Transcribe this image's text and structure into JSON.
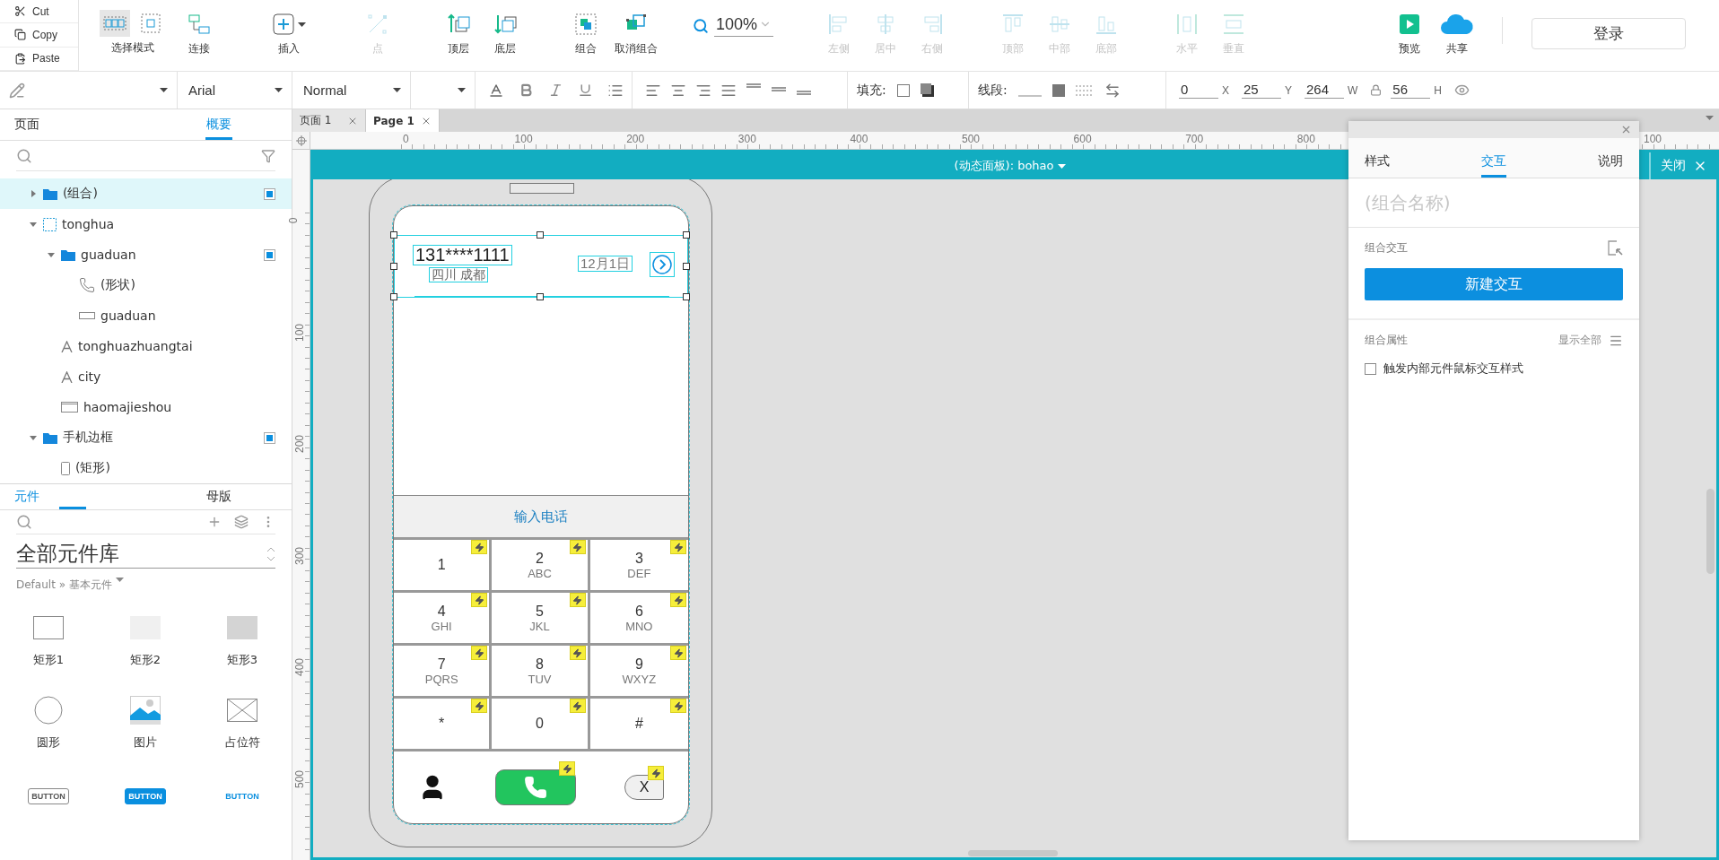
{
  "clipboard": [
    {
      "label": "Cut",
      "kind": "cut"
    },
    {
      "label": "Copy",
      "kind": "copy"
    },
    {
      "label": "Paste",
      "kind": "paste"
    }
  ],
  "select_mode": {
    "label": "选择模式",
    "modes": [
      {
        "kind": "intersect",
        "selected": true
      },
      {
        "kind": "contain",
        "selected": false
      }
    ]
  },
  "toolbar_left": [
    [
      {
        "label": "连接",
        "kind": "connect",
        "disabled": false
      }
    ],
    [
      {
        "label": "插入",
        "kind": "insert",
        "disabled": false
      }
    ],
    [
      {
        "label": "点",
        "kind": "point",
        "disabled": true
      }
    ],
    [
      {
        "label": "顶层",
        "kind": "front",
        "disabled": false
      },
      {
        "label": "底层",
        "kind": "back",
        "disabled": false
      }
    ],
    [
      {
        "label": "组合",
        "kind": "group",
        "disabled": false
      },
      {
        "label": "取消组合",
        "kind": "ungroup",
        "disabled": false
      }
    ]
  ],
  "zoom": "100%",
  "toolbar_align": [
    [
      {
        "label": "左侧",
        "kind": "align-left",
        "disabled": true
      },
      {
        "label": "居中",
        "kind": "align-center",
        "disabled": true
      },
      {
        "label": "右侧",
        "kind": "align-right",
        "disabled": true
      }
    ],
    [
      {
        "label": "顶部",
        "kind": "align-top",
        "disabled": true
      },
      {
        "label": "中部",
        "kind": "align-middle",
        "disabled": true
      },
      {
        "label": "底部",
        "kind": "align-bottom",
        "disabled": true
      }
    ],
    [
      {
        "label": "水平",
        "kind": "distribute-h",
        "disabled": true
      },
      {
        "label": "垂直",
        "kind": "distribute-v",
        "disabled": true
      }
    ]
  ],
  "toolbar_right": [
    {
      "label": "预览",
      "kind": "preview",
      "disabled": false
    },
    {
      "label": "共享",
      "kind": "share",
      "disabled": false
    }
  ],
  "login": "登录",
  "format_bar": {
    "font": "Arial",
    "style": "Normal",
    "fill_label": "填充:",
    "line_label": "线段:",
    "coords": [
      {
        "value": "0",
        "axis": "X"
      },
      {
        "value": "25",
        "axis": "Y"
      },
      {
        "value": "264",
        "axis": "W"
      },
      {
        "value": "56",
        "axis": "H"
      }
    ]
  },
  "outline": {
    "tabs": [
      {
        "label": "页面",
        "selected": false
      },
      {
        "label": "概要",
        "selected": true
      }
    ],
    "tree": [
      {
        "label": "(组合)",
        "kind": "folder",
        "expanded": false,
        "selected": true,
        "marker": true
      },
      {
        "label": "tonghua",
        "kind": "dynamic-panel",
        "expanded": true,
        "selected": false,
        "marker": false,
        "children": [
          {
            "label": "guaduan",
            "kind": "folder",
            "expanded": true,
            "selected": false,
            "marker": true,
            "children": [
              {
                "label": "(形状)",
                "kind": "phone",
                "selected": false,
                "marker": false
              },
              {
                "label": "guaduan",
                "kind": "rect",
                "selected": false,
                "marker": false
              }
            ]
          },
          {
            "label": "tonghuazhuangtai",
            "kind": "text",
            "selected": false,
            "marker": false
          },
          {
            "label": "city",
            "kind": "text",
            "selected": false,
            "marker": false
          },
          {
            "label": "haomajieshou",
            "kind": "field",
            "selected": false,
            "marker": false
          }
        ]
      },
      {
        "label": "手机边框",
        "kind": "folder",
        "expanded": true,
        "selected": false,
        "marker": true,
        "children": [
          {
            "label": "(矩形)",
            "kind": "mobile",
            "selected": false,
            "marker": false
          }
        ]
      }
    ]
  },
  "widgets": {
    "tabs": [
      {
        "label": "元件",
        "selected": true
      },
      {
        "label": "母版",
        "selected": false
      }
    ],
    "library": "全部元件库",
    "breadcrumb": "Default » 基本元件",
    "items": [
      {
        "kind": "rect1",
        "label": "矩形1"
      },
      {
        "kind": "rect2",
        "label": "矩形2"
      },
      {
        "kind": "rect3",
        "label": "矩形3"
      },
      {
        "kind": "circle",
        "label": "圆形"
      },
      {
        "kind": "image",
        "label": "图片"
      },
      {
        "kind": "placeholder",
        "label": "占位符"
      },
      {
        "kind": "button",
        "text": "BUTTON"
      },
      {
        "kind": "primary-button",
        "text": "BUTTON"
      },
      {
        "kind": "link-button",
        "text": "BUTTON"
      }
    ]
  },
  "doc_tabs": [
    {
      "label": "页面 1",
      "selected": false
    },
    {
      "label": "Page 1",
      "selected": true
    }
  ],
  "ruler": {
    "horizontal": [
      "0",
      "100",
      "200",
      "300",
      "400",
      "500",
      "600",
      "700",
      "800"
    ],
    "horizontal_tail": "100",
    "vertical": [
      "0",
      "100",
      "200",
      "300",
      "400",
      "500"
    ]
  },
  "stage": {
    "panel_name": "(动态面板): bohao",
    "close": "关闭"
  },
  "phone": {
    "number": "131****1111",
    "city": "四川 成都",
    "date": "12月1日",
    "input_label": "输入电话",
    "keys": [
      {
        "digit": "1",
        "interaction": true
      },
      {
        "digit": "2",
        "letters": "ABC",
        "interaction": true
      },
      {
        "digit": "3",
        "letters": "DEF",
        "interaction": true
      },
      {
        "digit": "4",
        "letters": "GHI",
        "interaction": true
      },
      {
        "digit": "5",
        "letters": "JKL",
        "interaction": true
      },
      {
        "digit": "6",
        "letters": "MNO",
        "interaction": true
      },
      {
        "digit": "7",
        "letters": "PQRS",
        "interaction": true
      },
      {
        "digit": "8",
        "letters": "TUV",
        "interaction": true
      },
      {
        "digit": "9",
        "letters": "WXYZ",
        "interaction": true
      },
      {
        "digit": "*",
        "interaction": true
      },
      {
        "digit": "0",
        "interaction": true
      },
      {
        "digit": "#",
        "interaction": true
      }
    ],
    "call_interaction": true,
    "delete": {
      "label": "X",
      "interaction": true
    }
  },
  "inspector": {
    "tabs": [
      {
        "label": "样式",
        "selected": false
      },
      {
        "label": "交互",
        "selected": true
      },
      {
        "label": "说明",
        "selected": false
      }
    ],
    "name_placeholder": "(组合名称)",
    "interaction_title": "组合交互",
    "new_interaction": "新建交互",
    "props_title": "组合属性",
    "show_all": "显示全部",
    "options": [
      {
        "label": "触发内部元件鼠标交互样式",
        "checked": false
      }
    ]
  }
}
